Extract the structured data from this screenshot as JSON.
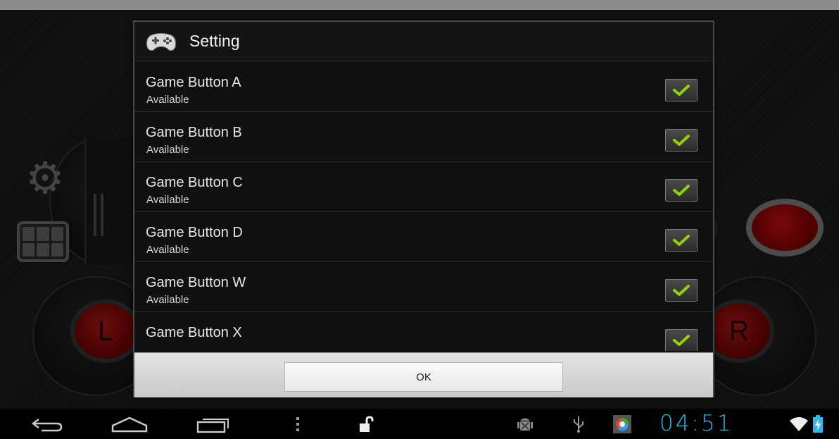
{
  "dialog": {
    "title": "Setting",
    "icon": "gamepad-icon",
    "items": [
      {
        "title": "Game Button A",
        "subtitle": "Available",
        "checked": true
      },
      {
        "title": "Game Button B",
        "subtitle": "Available",
        "checked": true
      },
      {
        "title": "Game Button C",
        "subtitle": "Available",
        "checked": true
      },
      {
        "title": "Game Button D",
        "subtitle": "Available",
        "checked": true
      },
      {
        "title": "Game Button W",
        "subtitle": "Available",
        "checked": true
      },
      {
        "title": "Game Button X",
        "subtitle": "",
        "checked": true
      }
    ],
    "ok_label": "OK"
  },
  "background": {
    "left_button_label": "L",
    "right_button_label": "R"
  },
  "status_bar": {
    "time": "04:51",
    "icons": [
      "debug-android-icon",
      "usb-icon",
      "app-notification-icon",
      "wifi-icon",
      "battery-icon"
    ]
  },
  "navbar": {
    "icons": [
      "back-icon",
      "home-icon",
      "recent-apps-icon",
      "menu-icon",
      "unlock-icon"
    ]
  },
  "colors": {
    "accent": "#33b5e5",
    "check": "#8fd400",
    "red_button": "#c21a1a"
  }
}
